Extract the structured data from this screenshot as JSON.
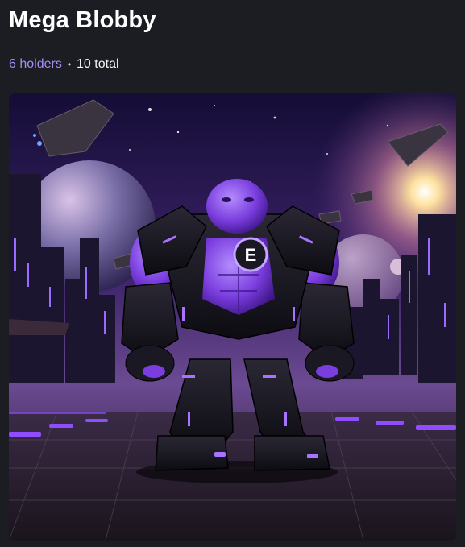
{
  "nft": {
    "title": "Mega Blobby",
    "holders": "6 holders",
    "separator": "•",
    "total": "10 total",
    "chest_emblem": "E"
  },
  "image": {
    "subject": "purple-muscular-robot-creature-icon",
    "accent_color": "#8f4dff",
    "secondary_color": "#a58cf5"
  }
}
